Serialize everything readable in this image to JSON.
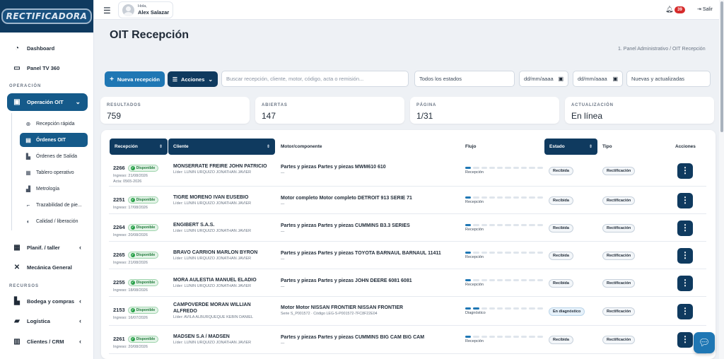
{
  "brand": {
    "logo_text": "RECTIFICADORA"
  },
  "user": {
    "greeting": "Hola,",
    "name": "Alex Salazar",
    "notifications": "39",
    "logout_label": "Salir"
  },
  "sidebar": {
    "dashboard": "Dashboard",
    "panel_tv": "Panel TV 360",
    "section_operacion": "OPERACIÓN",
    "operacion_oit": "Operación OIT",
    "sub_items": [
      "Recepción rápida",
      "Órdenes OIT",
      "Órdenes de Salida",
      "Tablero operativo",
      "Metrología",
      "Trazabilidad de pie...",
      "Calidad / liberación"
    ],
    "planif": "Planif. / taller",
    "mecanica": "Mecánica General",
    "section_recursos": "RECURSOS",
    "bodega": "Bodega y compras",
    "logistica": "Logística",
    "clientes": "Clientes / CRM"
  },
  "page": {
    "title": "OIT Recepción",
    "breadcrumb": "1. Panel Administrativo  /  OIT Recepción"
  },
  "toolbar": {
    "new_label": "Nueva recepción",
    "actions_label": "Acciones",
    "search_placeholder": "Buscar recepción, cliente, motor, código, acta o remisión...",
    "status_filter": "Todos los estados",
    "date_from": "dd/mm/aaaa",
    "date_to": "dd/mm/aaaa",
    "sort_filter": "Nuevas y actualizadas"
  },
  "stats": [
    {
      "label": "RESULTADOS",
      "value": "759"
    },
    {
      "label": "ABIERTAS",
      "value": "147"
    },
    {
      "label": "PÁGINA",
      "value": "1/31"
    },
    {
      "label": "ACTUALIZACIÓN",
      "value": "En línea"
    }
  ],
  "table": {
    "headers": {
      "recepcion": "Recepción",
      "cliente": "Cliente",
      "motor": "Motor/componente",
      "flujo": "Flujo",
      "estado": "Estado",
      "tipo": "Tipo",
      "acciones": "Acciones"
    },
    "disponible": "Disponible",
    "rows": [
      {
        "num": "2266",
        "ingreso": "Ingreso: 21/08/2026",
        "acta": "Acta: 0565-2026",
        "cliente": "MONSERRATE FREIRE JOHN PATRICIO",
        "cliente2": "",
        "lider": "Líder: LUNIN URQUIZO JONATHAN JAVIER",
        "motor": "Partes y piezas Partes y piezas MWM610 610",
        "motor_sub": "—",
        "flujo": "Recepción",
        "flow_step": 1,
        "estado": "Recibida",
        "tipo": "Rectificación"
      },
      {
        "num": "2251",
        "ingreso": "Ingreso: 17/08/2026",
        "acta": "",
        "cliente": "TIGRE MORENO IVAN EUSEBIO",
        "cliente2": "",
        "lider": "Líder: LUNIN URQUIZO JONATHAN JAVIER",
        "motor": "Motor completo Motor completo DETROIT 913 SERIE 71",
        "motor_sub": "—",
        "flujo": "Recepción",
        "flow_step": 1,
        "estado": "Recibida",
        "tipo": "Rectificación"
      },
      {
        "num": "2264",
        "ingreso": "Ingreso: 20/08/2026",
        "acta": "",
        "cliente": "ENGIBERT S.A.S.",
        "cliente2": "",
        "lider": "Líder: LUNIN URQUIZO JONATHAN JAVIER",
        "motor": "Partes y piezas Partes y piezas CUMMINS B3.3 SERIES",
        "motor_sub": "—",
        "flujo": "Recepción",
        "flow_step": 1,
        "estado": "Recibida",
        "tipo": "Rectificación"
      },
      {
        "num": "2265",
        "ingreso": "Ingreso: 21/08/2026",
        "acta": "",
        "cliente": "BRAVO CARRION MARLON BYRON",
        "cliente2": "",
        "lider": "Líder: LUNIN URQUIZO JONATHAN JAVIER",
        "motor": "Partes y piezas Partes y piezas TOYOTA BARNAUL BARNAUL 11411",
        "motor_sub": "—",
        "flujo": "Recepción",
        "flow_step": 1,
        "estado": "Recibida",
        "tipo": "Rectificación"
      },
      {
        "num": "2255",
        "ingreso": "Ingreso: 18/08/2026",
        "acta": "",
        "cliente": "MORA AULESTIA MANUEL ELADIO",
        "cliente2": "",
        "lider": "Líder: LUNIN URQUIZO JONATHAN JAVIER",
        "motor": "Partes y piezas Partes y piezas JOHN DEERE 6081 6081",
        "motor_sub": "—",
        "flujo": "Recepción",
        "flow_step": 1,
        "estado": "Recibida",
        "tipo": "Rectificación"
      },
      {
        "num": "2153",
        "ingreso": "Ingreso: 16/07/2026",
        "acta": "",
        "cliente": "CAMPOVERDE MORAN WILLIAN",
        "cliente2": "ALFREDO",
        "lider": "Líder: AVILA ALBURQUEQUE KEBIN DANIEL",
        "motor": "Motor Motor NISSAN FRONTIER NISSAN FRONTIER",
        "motor_sub": "Serie S_P001572 · Código LEG-S-P001572-7FC8F22E04",
        "flujo": "Diagnóstico",
        "flow_step": 2,
        "estado": "En diagnóstico",
        "tipo": "Rectificación"
      },
      {
        "num": "2261",
        "ingreso": "Ingreso: 20/08/2026",
        "acta": "",
        "cliente": "MADSEN S.A / MADSEN",
        "cliente2": "",
        "lider": "Líder: LUNIN URQUIZO JONATHAN JAVIER",
        "motor": "Partes y piezas Partes y piezas CUMMINS BIG CAM BIG CAM",
        "motor_sub": "—",
        "flujo": "Recepción",
        "flow_step": 1,
        "estado": "Recibida",
        "tipo": "Rectificación"
      }
    ]
  },
  "colors": {
    "primary": "#1f77b4",
    "dark": "#0f3a5f",
    "badge": "#d62b2b",
    "success": "#26a047"
  }
}
